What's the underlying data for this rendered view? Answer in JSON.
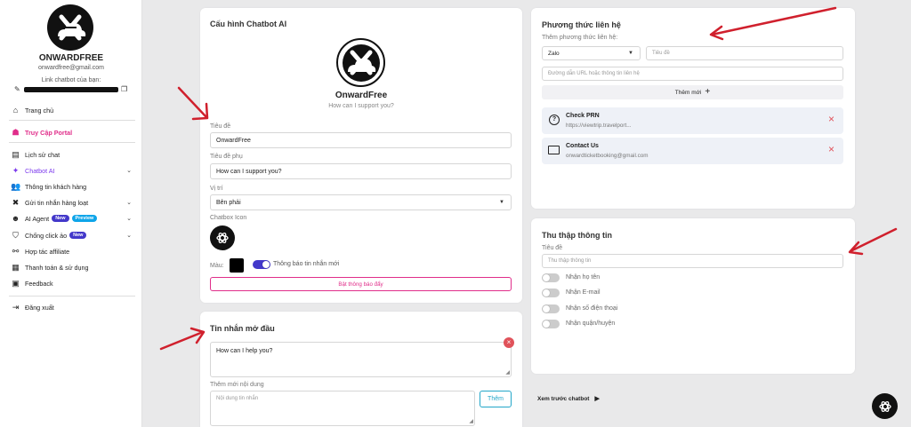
{
  "sidebar": {
    "name": "ONWARDFREE",
    "email": "onwardfree@gmail.com",
    "link_label": "Link chatbot của bạn:",
    "items": [
      {
        "label": "Trang chủ",
        "icon": "home-icon"
      },
      {
        "label": "Truy Cập Portal",
        "icon": "portal-icon"
      },
      {
        "label": "Lịch sử chat",
        "icon": "chat-history-icon"
      },
      {
        "label": "Chatbot AI",
        "icon": "sparkle-icon"
      },
      {
        "label": "Thông tin khách hàng",
        "icon": "users-icon"
      },
      {
        "label": "Gửi tin nhắn hàng loạt",
        "icon": "tools-icon"
      },
      {
        "label": "AI Agent",
        "icon": "robot-icon",
        "badges": [
          "New",
          "Preview"
        ]
      },
      {
        "label": "Chống click ảo",
        "icon": "shield-icon",
        "badges": [
          "New"
        ]
      },
      {
        "label": "Hợp tác affiliate",
        "icon": "affiliate-icon"
      },
      {
        "label": "Thanh toán & sử dụng",
        "icon": "billing-icon"
      },
      {
        "label": "Feedback",
        "icon": "feedback-icon"
      },
      {
        "label": "Đăng xuất",
        "icon": "logout-icon"
      }
    ]
  },
  "config": {
    "title": "Cấu hình Chatbot AI",
    "bot_name": "OnwardFree",
    "bot_sub": "How can I support you?",
    "title_label": "Tiêu đề",
    "title_value": "OnwardFree",
    "subtitle_label": "Tiêu đề phụ",
    "subtitle_value": "How can I support you?",
    "position_label": "Vị trí",
    "position_value": "Bên phải",
    "icon_label": "Chatbox Icon",
    "color_label": "Màu:",
    "color_value": "#000000",
    "notify_label": "Thông báo tin nhắn mới",
    "notify_button": "Bật thông báo đẩy"
  },
  "opening": {
    "title": "Tin nhắn mở đầu",
    "message": "How can I help you?",
    "add_label": "Thêm mới nội dung",
    "add_placeholder": "Nội dung tin nhắn",
    "add_button": "Thêm"
  },
  "contact": {
    "title": "Phương thức liên hệ",
    "add_label": "Thêm phương thức liên hệ:",
    "type_value": "Zalo",
    "title_placeholder": "Tiêu đề",
    "url_placeholder": "Đường dẫn URL hoặc thông tin liên hệ",
    "add_button": "Thêm mới",
    "items": [
      {
        "title": "Check PRN",
        "detail": "https://viewtrip.travelport...",
        "icon": "question-icon"
      },
      {
        "title": "Contact Us",
        "detail": "onwardticketbooking@gmail.com",
        "icon": "mail-icon"
      }
    ]
  },
  "collect": {
    "title": "Thu thập thông tin",
    "title_label": "Tiêu đề",
    "title_placeholder": "Thu thập thông tin",
    "options": [
      {
        "label": "Nhận họ tên",
        "enabled": false
      },
      {
        "label": "Nhận E-mail",
        "enabled": false
      },
      {
        "label": "Nhận số điện thoại",
        "enabled": false
      },
      {
        "label": "Nhận quận/huyện",
        "enabled": false
      }
    ]
  },
  "preview": {
    "label": "Xem trước chatbot"
  },
  "colors": {
    "accent": "#4338ca",
    "portal": "#e02d8a",
    "active": "#7c3aed",
    "arrow": "#d0202d",
    "delete": "#e0525a"
  }
}
